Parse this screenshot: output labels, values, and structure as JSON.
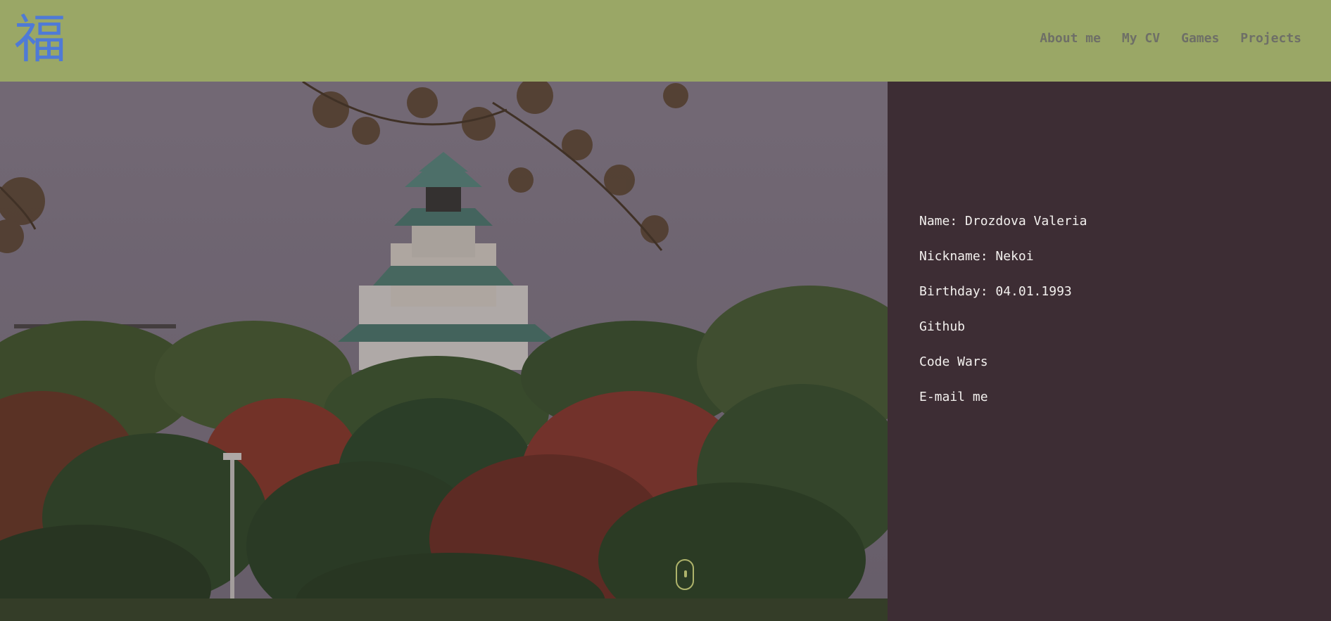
{
  "header": {
    "logo": "福",
    "nav": [
      "About me",
      "My CV",
      "Games",
      "Projects"
    ]
  },
  "profile": {
    "name": "Name: Drozdova Valeria",
    "nickname": "Nickname: Nekoi",
    "birthday": "Birthday: 04.01.1993",
    "github": "Github",
    "codewars": "Code Wars",
    "email": "E-mail me"
  },
  "colors": {
    "header_bg": "#9aa766",
    "logo": "#4f7ad6",
    "nav_text": "#6e6f67",
    "panel_bg": "#3d2d34",
    "panel_text": "#f3f0ee"
  }
}
